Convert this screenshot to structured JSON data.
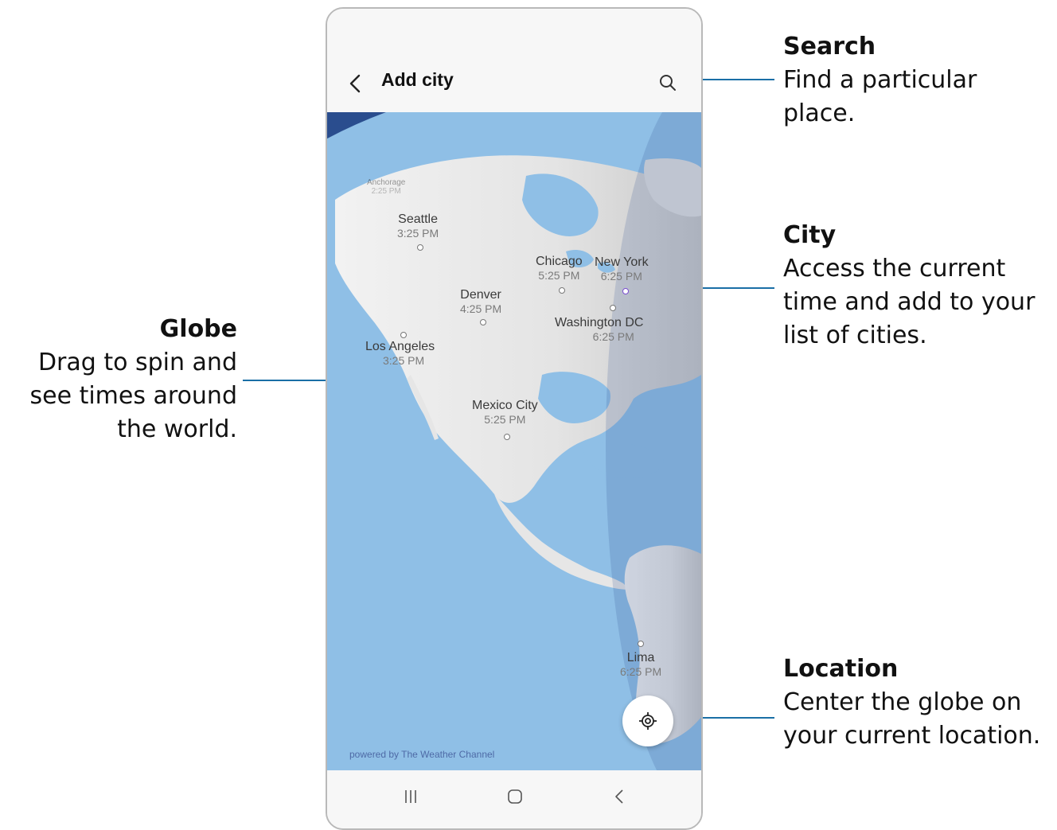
{
  "app": {
    "title": "Add city"
  },
  "annotations": {
    "search": {
      "title": "Search",
      "desc": "Find a particular place."
    },
    "city": {
      "title": "City",
      "desc": "Access the current time and add to your list of cities."
    },
    "globe": {
      "title": "Globe",
      "desc": "Drag to spin and see times around the world."
    },
    "location": {
      "title": "Location",
      "desc": "Center the globe on your current location."
    }
  },
  "cities": [
    {
      "name": "Anchorage",
      "time": "2:25 PM"
    },
    {
      "name": "Seattle",
      "time": "3:25 PM"
    },
    {
      "name": "Chicago",
      "time": "5:25 PM"
    },
    {
      "name": "New York",
      "time": "6:25 PM"
    },
    {
      "name": "Denver",
      "time": "4:25 PM"
    },
    {
      "name": "Washington DC",
      "time": "6:25 PM"
    },
    {
      "name": "Los Angeles",
      "time": "3:25 PM"
    },
    {
      "name": "Mexico City",
      "time": "5:25 PM"
    },
    {
      "name": "Lima",
      "time": "6:25 PM"
    }
  ],
  "footer": {
    "powered_by": "powered by The Weather Channel"
  },
  "colors": {
    "ocean": "#8fbfe6",
    "land": "#e8e8e8",
    "space": "#2a4d8e",
    "leader": "#1a6fa6"
  },
  "icons": {
    "back": "chevron-left-icon",
    "search": "search-icon",
    "location": "crosshair-icon",
    "recents": "recents-icon",
    "home": "home-icon",
    "nav_back": "nav-back-icon"
  }
}
